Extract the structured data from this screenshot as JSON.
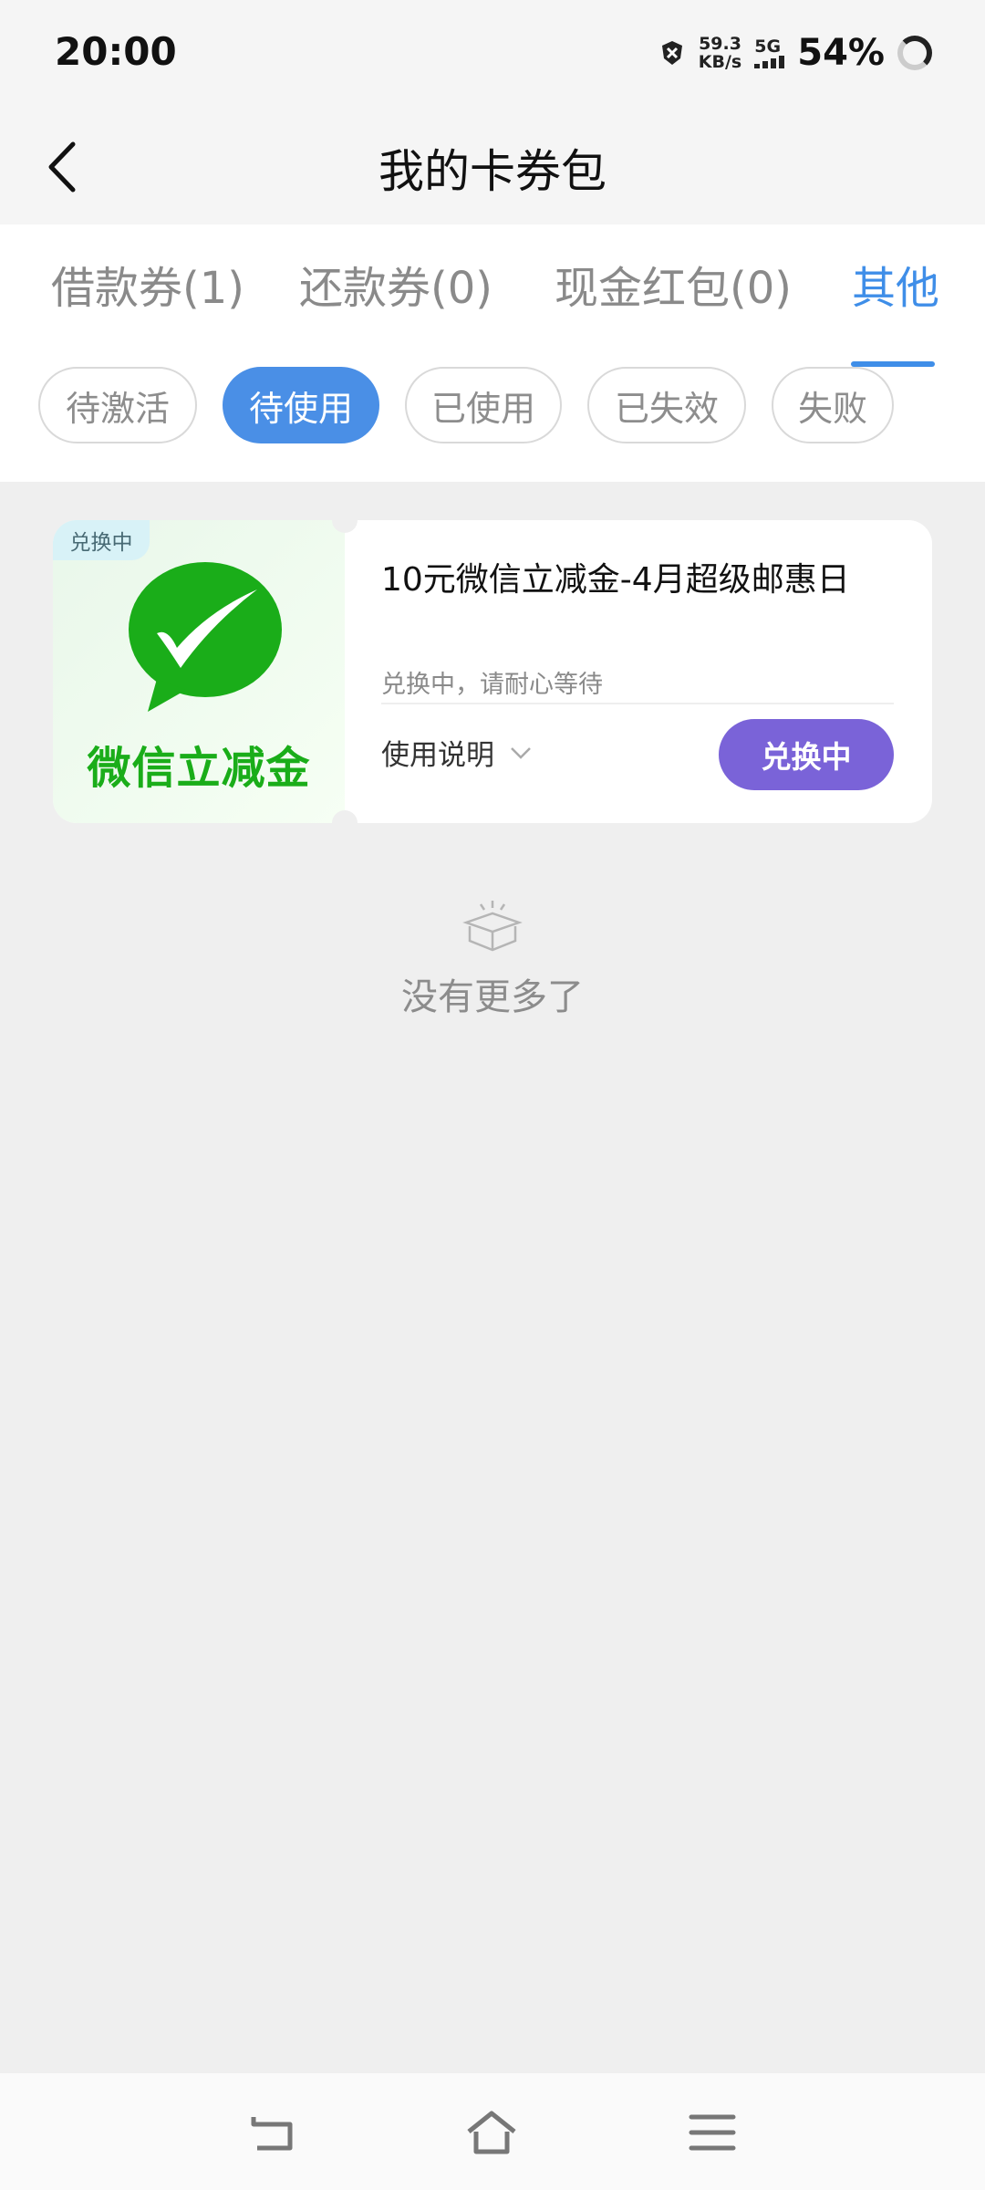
{
  "status_bar": {
    "time": "20:00",
    "speed_value": "59.3",
    "speed_unit": "KB/s",
    "network": "5G",
    "battery": "54%"
  },
  "header": {
    "title": "我的卡券包",
    "back_icon": "chevron-left-icon"
  },
  "tabs": [
    {
      "label": "借款券(1)",
      "active": false
    },
    {
      "label": "还款券(0)",
      "active": false
    },
    {
      "label": "现金红包(0)",
      "active": false
    },
    {
      "label": "其他",
      "active": true
    }
  ],
  "filters": [
    {
      "label": "待激活",
      "active": false
    },
    {
      "label": "待使用",
      "active": true
    },
    {
      "label": "已使用",
      "active": false
    },
    {
      "label": "已失效",
      "active": false
    },
    {
      "label": "失败",
      "active": false
    }
  ],
  "coupon": {
    "status_tag": "兑换中",
    "image_text": "微信立减金",
    "title": "10元微信立减金-4月超级邮惠日",
    "note": "兑换中，请耐心等待",
    "instructions_label": "使用说明",
    "button_label": "兑换中"
  },
  "empty_state": {
    "text": "没有更多了",
    "icon": "empty-box-icon"
  },
  "navbar": {
    "back": "back-icon",
    "home": "home-icon",
    "menu": "menu-icon"
  },
  "colors": {
    "accent": "#3f8ee8",
    "button": "#7a63d8",
    "wechat_green": "#1aad19"
  }
}
